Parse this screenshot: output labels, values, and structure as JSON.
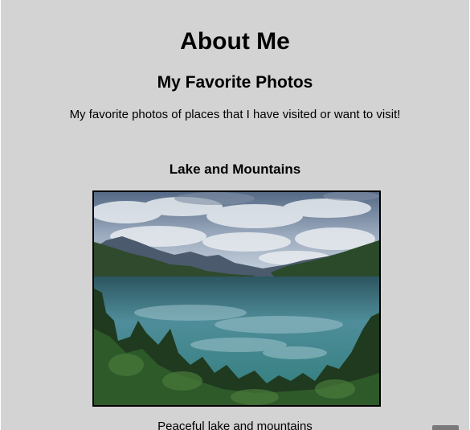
{
  "page": {
    "title": "About Me",
    "subtitle": "My Favorite Photos",
    "intro": "My favorite photos of places that I have visited or want to visit!"
  },
  "photos": [
    {
      "heading": "Lake and Mountains",
      "caption": "Peaceful lake and mountains"
    }
  ],
  "colors": {
    "background": "#d3d3d3",
    "text": "#000000"
  }
}
